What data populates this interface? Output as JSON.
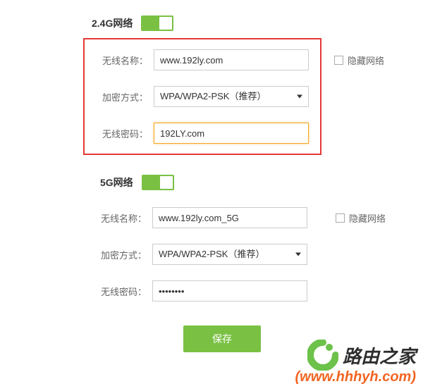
{
  "section24": {
    "title": "2.4G网络",
    "toggle_on": true,
    "ssid_label": "无线名称：",
    "ssid_value": "www.192ly.com",
    "hide_label": "隐藏网络",
    "enc_label": "加密方式：",
    "enc_value": "WPA/WPA2-PSK（推荐）",
    "pwd_label": "无线密码：",
    "pwd_value": "192LY.com"
  },
  "section5": {
    "title": "5G网络",
    "toggle_on": true,
    "ssid_label": "无线名称：",
    "ssid_value": "www.192ly.com_5G",
    "hide_label": "隐藏网络",
    "enc_label": "加密方式：",
    "enc_value": "WPA/WPA2-PSK（推荐）",
    "pwd_label": "无线密码：",
    "pwd_value": "••••••••"
  },
  "save_label": "保存",
  "watermark": {
    "brand": "路由之家",
    "url": "(www.hhhyh.com)"
  },
  "colors": {
    "accent_green": "#7ac143",
    "highlight_red": "#e53935",
    "focus_orange": "#f5a623",
    "wm_orange": "#f26522"
  }
}
